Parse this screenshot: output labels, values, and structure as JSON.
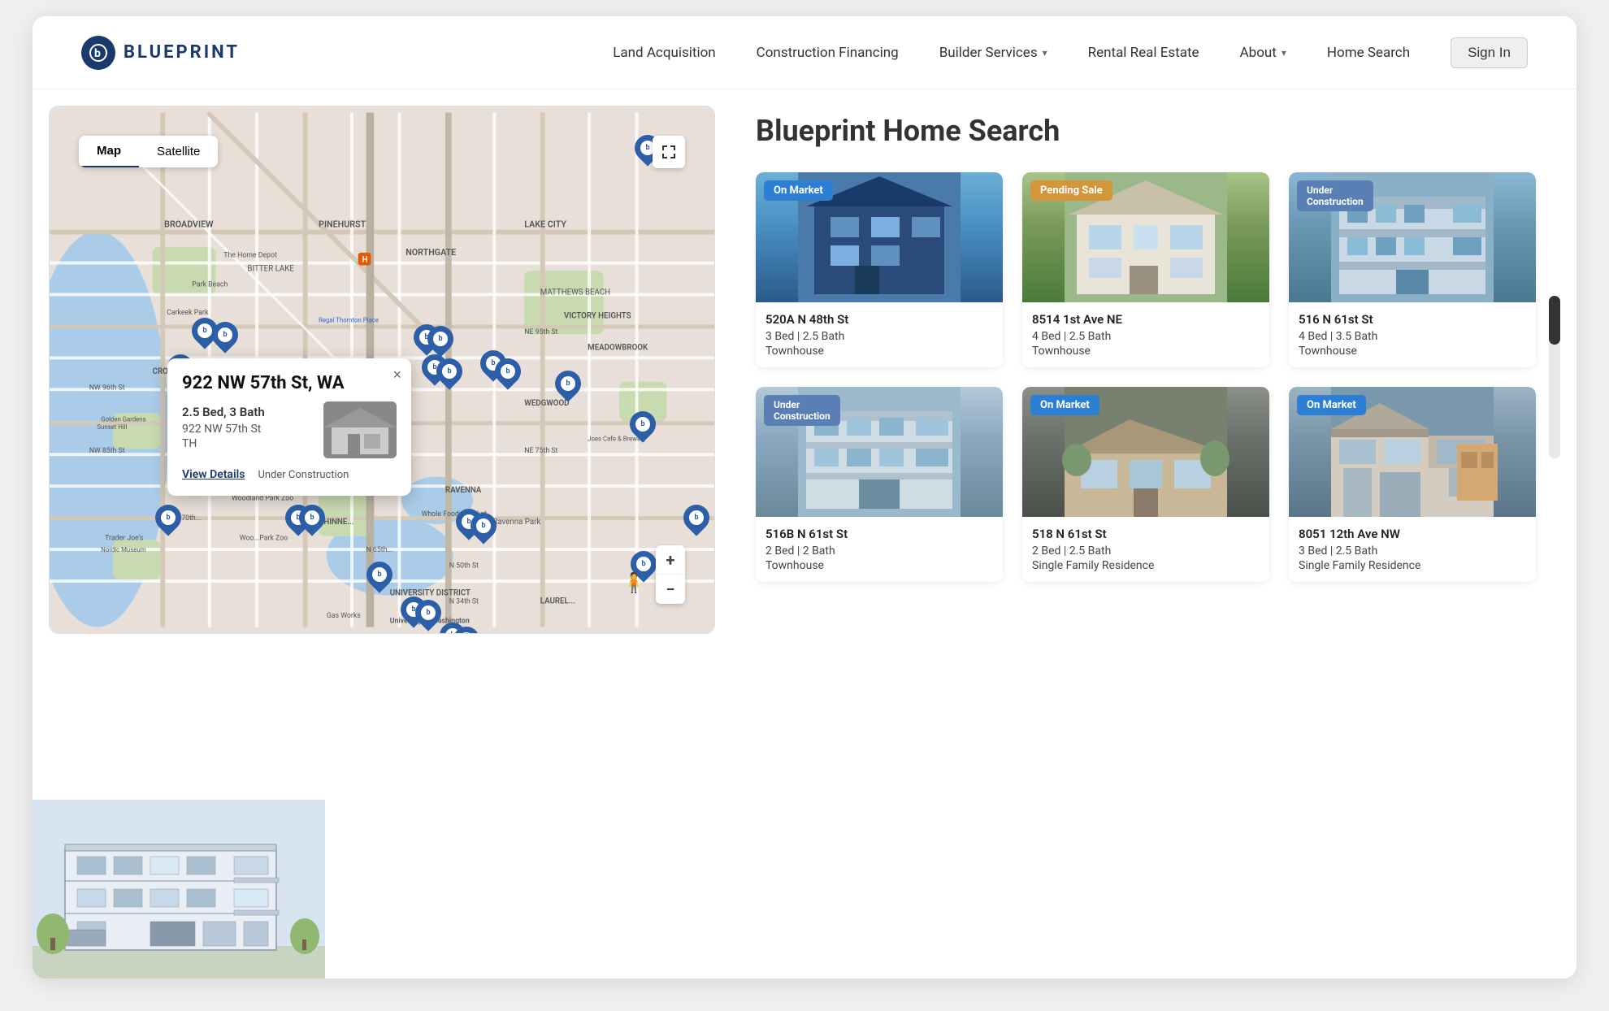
{
  "brand": {
    "logo_letter": "b",
    "name": "BLUEPRINT"
  },
  "nav": {
    "links": [
      {
        "label": "Land Acquisition",
        "has_dropdown": false
      },
      {
        "label": "Construction Financing",
        "has_dropdown": false
      },
      {
        "label": "Builder Services",
        "has_dropdown": true
      },
      {
        "label": "Rental Real Estate",
        "has_dropdown": false
      },
      {
        "label": "About",
        "has_dropdown": true
      },
      {
        "label": "Home Search",
        "has_dropdown": false
      },
      {
        "label": "Sign In",
        "is_button": true
      }
    ]
  },
  "map": {
    "toggle_map_label": "Map",
    "toggle_satellite_label": "Satellite",
    "expand_icon": "⛶",
    "zoom_in": "+",
    "zoom_out": "−",
    "popup": {
      "title": "922 NW 57th St, WA",
      "beds_baths": "2.5 Bed, 3 Bath",
      "address": "922 NW 57th St",
      "type": "TH",
      "view_details": "View Details",
      "status": "Under Construction",
      "close": "×"
    }
  },
  "right_panel": {
    "title": "Blueprint Home Search",
    "listings": [
      {
        "badge": "On Market",
        "badge_type": "on-market",
        "address": "520A N 48th St",
        "beds_baths": "3 Bed | 2.5 Bath",
        "type": "Townhouse",
        "img_class": "house-img-1"
      },
      {
        "badge": "Pending Sale",
        "badge_type": "pending",
        "address": "8514 1st Ave NE",
        "beds_baths": "4 Bed | 2.5 Bath",
        "type": "Townhouse",
        "img_class": "house-img-2"
      },
      {
        "badge": "Under Construction",
        "badge_type": "under-construction",
        "address": "516 N 61st St",
        "beds_baths": "4 Bed | 3.5 Bath",
        "type": "Townhouse",
        "img_class": "house-img-3"
      },
      {
        "badge": "Under Construction",
        "badge_type": "under-construction",
        "address": "516B N 61st St",
        "beds_baths": "2 Bed | 2 Bath",
        "type": "Townhouse",
        "img_class": "house-img-4"
      },
      {
        "badge": "On Market",
        "badge_type": "on-market",
        "address": "518 N 61st St",
        "beds_baths": "2 Bed | 2.5 Bath",
        "type": "Single Family Residence",
        "img_class": "house-img-5"
      },
      {
        "badge": "On Market",
        "badge_type": "on-market",
        "address": "8051 12th Ave NW",
        "beds_baths": "3 Bed | 2.5 Bath",
        "type": "Single Family Residence",
        "img_class": "house-img-6"
      }
    ]
  }
}
